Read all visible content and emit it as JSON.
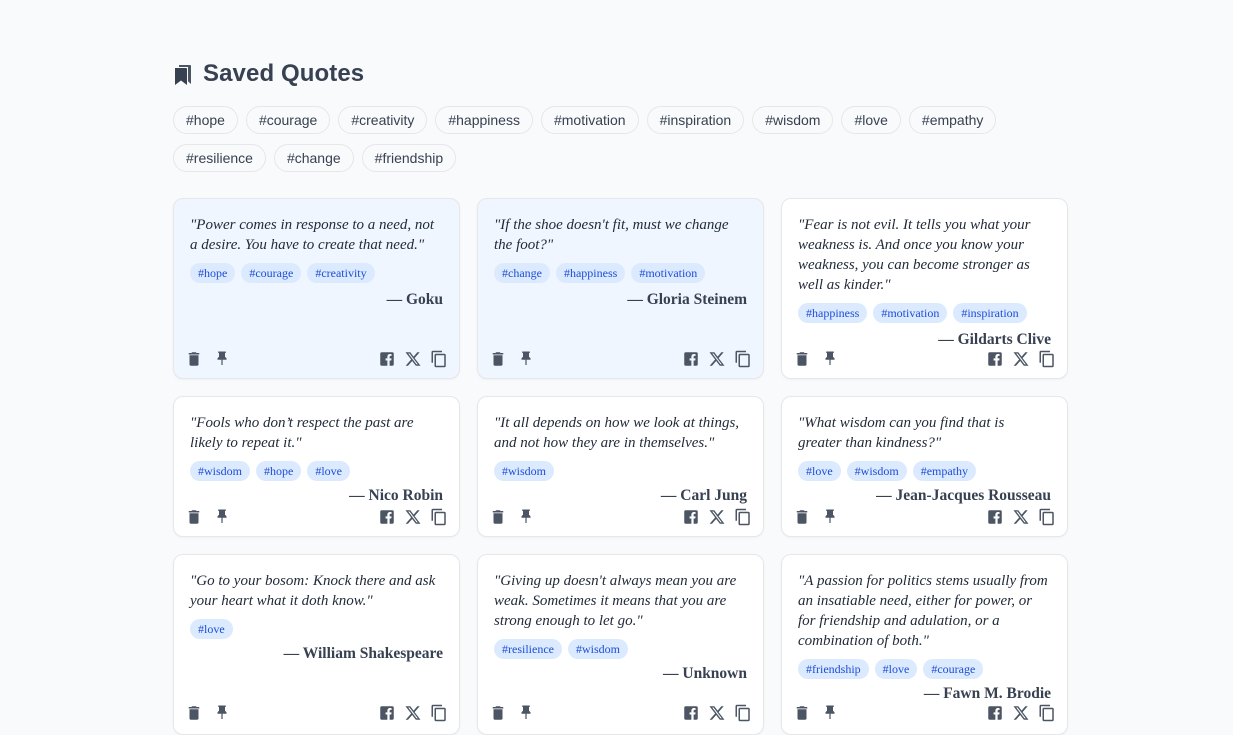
{
  "page_title": "Saved Quotes",
  "tag_cloud": [
    "#hope",
    "#courage",
    "#creativity",
    "#happiness",
    "#motivation",
    "#inspiration",
    "#wisdom",
    "#love",
    "#empathy",
    "#resilience",
    "#change",
    "#friendship"
  ],
  "colors": {
    "accent": "#1d4ed8",
    "tag_bg": "#dbeafe",
    "pinned_bg": "#eff6ff"
  },
  "icons": {
    "title": "bookmark-icon",
    "actions_left": [
      "trash-icon",
      "pin-icon"
    ],
    "actions_right": [
      "facebook-icon",
      "x-icon",
      "copy-icon"
    ]
  },
  "quotes": [
    {
      "text": "\"Power comes in response to a need, not a desire. You have to create that need.\"",
      "tags": [
        "#hope",
        "#courage",
        "#creativity"
      ],
      "author": "— Goku",
      "pinned": true
    },
    {
      "text": "\"If the shoe doesn't fit, must we change the foot?\"",
      "tags": [
        "#change",
        "#happiness",
        "#motivation"
      ],
      "author": "— Gloria Steinem",
      "pinned": true
    },
    {
      "text": "\"Fear is not evil. It tells you what your weakness is. And once you know your weakness, you can become stronger as well as kinder.\"",
      "tags": [
        "#happiness",
        "#motivation",
        "#inspiration"
      ],
      "author": "— Gildarts Clive",
      "pinned": false
    },
    {
      "text": "\"Fools who don’t respect the past are likely to repeat it.\"",
      "tags": [
        "#wisdom",
        "#hope",
        "#love"
      ],
      "author": "— Nico Robin",
      "pinned": false
    },
    {
      "text": "\"It all depends on how we look at things, and not how they are in themselves.\"",
      "tags": [
        "#wisdom"
      ],
      "author": "— Carl Jung",
      "pinned": false
    },
    {
      "text": "\"What wisdom can you find that is greater than kindness?\"",
      "tags": [
        "#love",
        "#wisdom",
        "#empathy"
      ],
      "author": "— Jean-Jacques Rousseau",
      "pinned": false
    },
    {
      "text": "\"Go to your bosom: Knock there and ask your heart what it doth know.\"",
      "tags": [
        "#love"
      ],
      "author": "— William Shakespeare",
      "pinned": false
    },
    {
      "text": "\"Giving up doesn't always mean you are weak. Sometimes it means that you are strong enough to let go.\"",
      "tags": [
        "#resilience",
        "#wisdom"
      ],
      "author": "— Unknown",
      "pinned": false
    },
    {
      "text": "\"A passion for politics stems usually from an insatiable need, either for power, or for friendship and adulation, or a combination of both.\"",
      "tags": [
        "#friendship",
        "#love",
        "#courage"
      ],
      "author": "— Fawn M. Brodie",
      "pinned": false
    }
  ]
}
